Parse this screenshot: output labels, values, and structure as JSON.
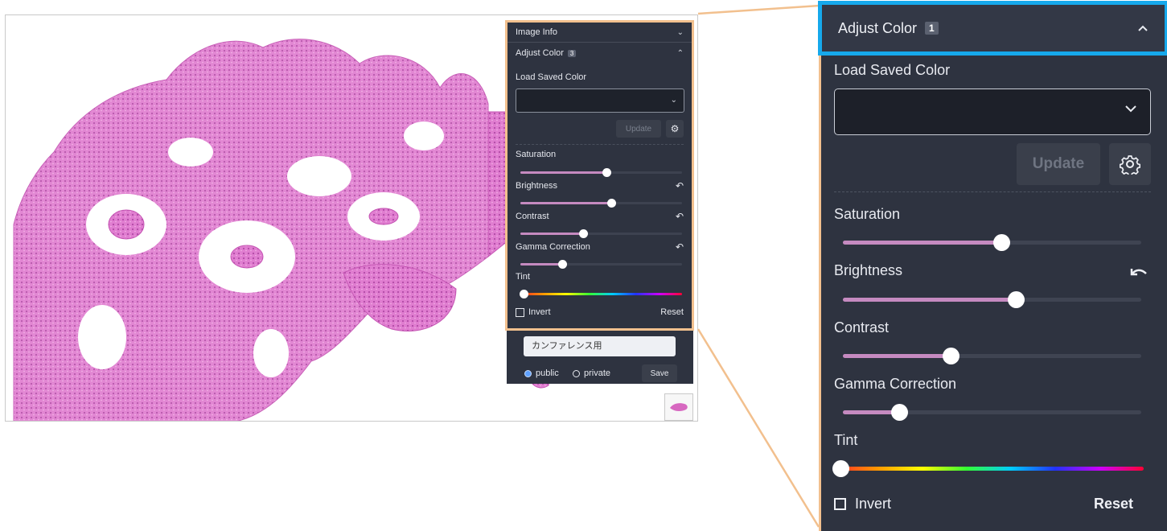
{
  "colors": {
    "panel_bg": "#2e3340",
    "highlight_border": "#16a9ec",
    "callout_border": "#f2c08e",
    "slider_fill": "#c58ac0",
    "tissue_pink": "#d768c0"
  },
  "panel": {
    "image_info_label": "Image Info",
    "adjust_color_label": "Adjust Color",
    "zoomed_badge": "1",
    "mini_badge": "3",
    "load_saved_color_label": "Load Saved Color",
    "update_label": "Update",
    "sliders": [
      {
        "label": "Saturation",
        "value": 0.53,
        "resettable": false
      },
      {
        "label": "Brightness",
        "value": 0.58,
        "resettable": true
      },
      {
        "label": "Contrast",
        "value": 0.36,
        "resettable": true
      },
      {
        "label": "Gamma Correction",
        "value": 0.19,
        "resettable": true
      },
      {
        "label": "Tint",
        "value": 0.02,
        "resettable": false
      }
    ],
    "invert_label": "Invert",
    "reset_label": "Reset"
  },
  "save_form": {
    "name_value": "カンファレンス用",
    "public_label": "public",
    "private_label": "private",
    "selected": "public",
    "save_label": "Save"
  },
  "icons": {
    "collapse": "chevron-up-icon",
    "expand": "chevron-down-icon",
    "settings": "gear-icon",
    "undo": "undo-icon"
  }
}
